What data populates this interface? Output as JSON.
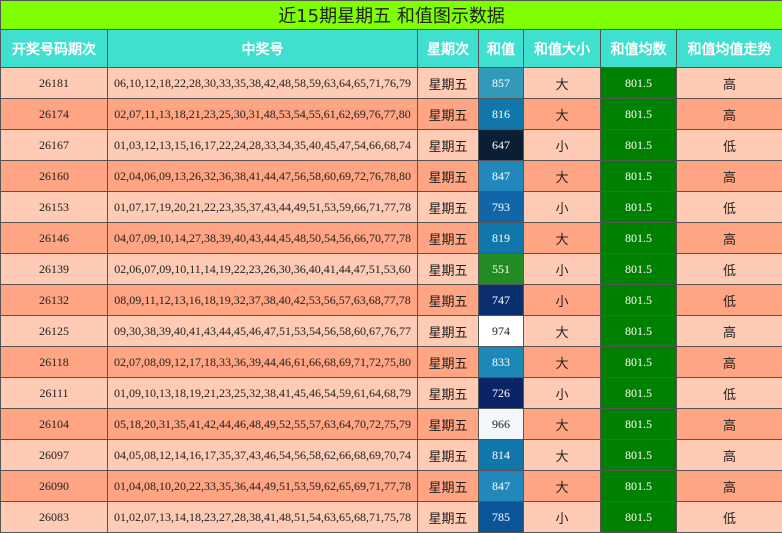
{
  "title": "近15期星期五 和值图示数据",
  "headers": [
    "开奖号码期次",
    "中奖号",
    "星期次",
    "和值",
    "和值大小",
    "和值均数",
    "和值均值走势"
  ],
  "rows": [
    {
      "period": "26181",
      "numbers": "06,10,12,18,22,28,30,33,35,38,42,48,58,59,63,64,65,71,76,79",
      "weekday": "星期五",
      "sum": "857",
      "size": "大",
      "avg": "801.5",
      "trend": "高",
      "sum_color": "#3399bb"
    },
    {
      "period": "26174",
      "numbers": "02,07,11,13,18,21,23,25,30,31,48,53,54,55,61,62,69,76,77,80",
      "weekday": "星期五",
      "sum": "816",
      "size": "大",
      "avg": "801.5",
      "trend": "高",
      "sum_color": "#1177aa"
    },
    {
      "period": "26167",
      "numbers": "01,03,12,13,15,16,17,22,24,28,33,34,35,40,45,47,54,66,68,74",
      "weekday": "星期五",
      "sum": "647",
      "size": "小",
      "avg": "801.5",
      "trend": "低",
      "sum_color": "#0a1f33"
    },
    {
      "period": "26160",
      "numbers": "02,04,06,09,13,26,32,36,38,41,44,47,56,58,60,69,72,76,78,80",
      "weekday": "星期五",
      "sum": "847",
      "size": "大",
      "avg": "801.5",
      "trend": "高",
      "sum_color": "#2288bb"
    },
    {
      "period": "26153",
      "numbers": "01,07,17,19,20,21,22,23,35,37,43,44,49,51,53,59,66,71,77,78",
      "weekday": "星期五",
      "sum": "793",
      "size": "小",
      "avg": "801.5",
      "trend": "低",
      "sum_color": "#1166aa"
    },
    {
      "period": "26146",
      "numbers": "04,07,09,10,14,27,38,39,40,43,44,45,48,50,54,56,66,70,77,78",
      "weekday": "星期五",
      "sum": "819",
      "size": "大",
      "avg": "801.5",
      "trend": "高",
      "sum_color": "#1177aa"
    },
    {
      "period": "26139",
      "numbers": "02,06,07,09,10,11,14,19,22,23,26,30,36,40,41,44,47,51,53,60",
      "weekday": "星期五",
      "sum": "551",
      "size": "小",
      "avg": "801.5",
      "trend": "低",
      "sum_color": "#228b22"
    },
    {
      "period": "26132",
      "numbers": "08,09,11,12,13,16,18,19,32,37,38,40,42,53,56,57,63,68,77,78",
      "weekday": "星期五",
      "sum": "747",
      "size": "小",
      "avg": "801.5",
      "trend": "低",
      "sum_color": "#0a2f6f"
    },
    {
      "period": "26125",
      "numbers": "09,30,38,39,40,41,43,44,45,46,47,51,53,54,56,58,60,67,76,77",
      "weekday": "星期五",
      "sum": "974",
      "size": "大",
      "avg": "801.5",
      "trend": "高",
      "sum_color": "#ffffff"
    },
    {
      "period": "26118",
      "numbers": "02,07,08,09,12,17,18,33,36,39,44,46,61,66,68,69,71,72,75,80",
      "weekday": "星期五",
      "sum": "833",
      "size": "大",
      "avg": "801.5",
      "trend": "高",
      "sum_color": "#1b88b8"
    },
    {
      "period": "26111",
      "numbers": "01,09,10,13,18,19,21,23,25,32,38,41,45,46,54,59,61,64,68,79",
      "weekday": "星期五",
      "sum": "726",
      "size": "小",
      "avg": "801.5",
      "trend": "低",
      "sum_color": "#0a2266"
    },
    {
      "period": "26104",
      "numbers": "05,18,20,31,35,41,42,44,46,48,49,52,55,57,63,64,70,72,75,79",
      "weekday": "星期五",
      "sum": "966",
      "size": "大",
      "avg": "801.5",
      "trend": "高",
      "sum_color": "#f5f8fb"
    },
    {
      "period": "26097",
      "numbers": "04,05,08,12,14,16,17,35,37,43,46,54,56,58,62,66,68,69,70,74",
      "weekday": "星期五",
      "sum": "814",
      "size": "大",
      "avg": "801.5",
      "trend": "高",
      "sum_color": "#1177aa"
    },
    {
      "period": "26090",
      "numbers": "01,04,08,10,20,22,33,35,36,44,49,51,53,59,62,65,69,71,77,78",
      "weekday": "星期五",
      "sum": "847",
      "size": "大",
      "avg": "801.5",
      "trend": "高",
      "sum_color": "#2288bb"
    },
    {
      "period": "26083",
      "numbers": "01,02,07,13,14,18,23,27,28,38,41,48,51,54,63,65,68,71,75,78",
      "weekday": "星期五",
      "sum": "785",
      "size": "小",
      "avg": "801.5",
      "trend": "低",
      "sum_color": "#0a5599"
    }
  ]
}
